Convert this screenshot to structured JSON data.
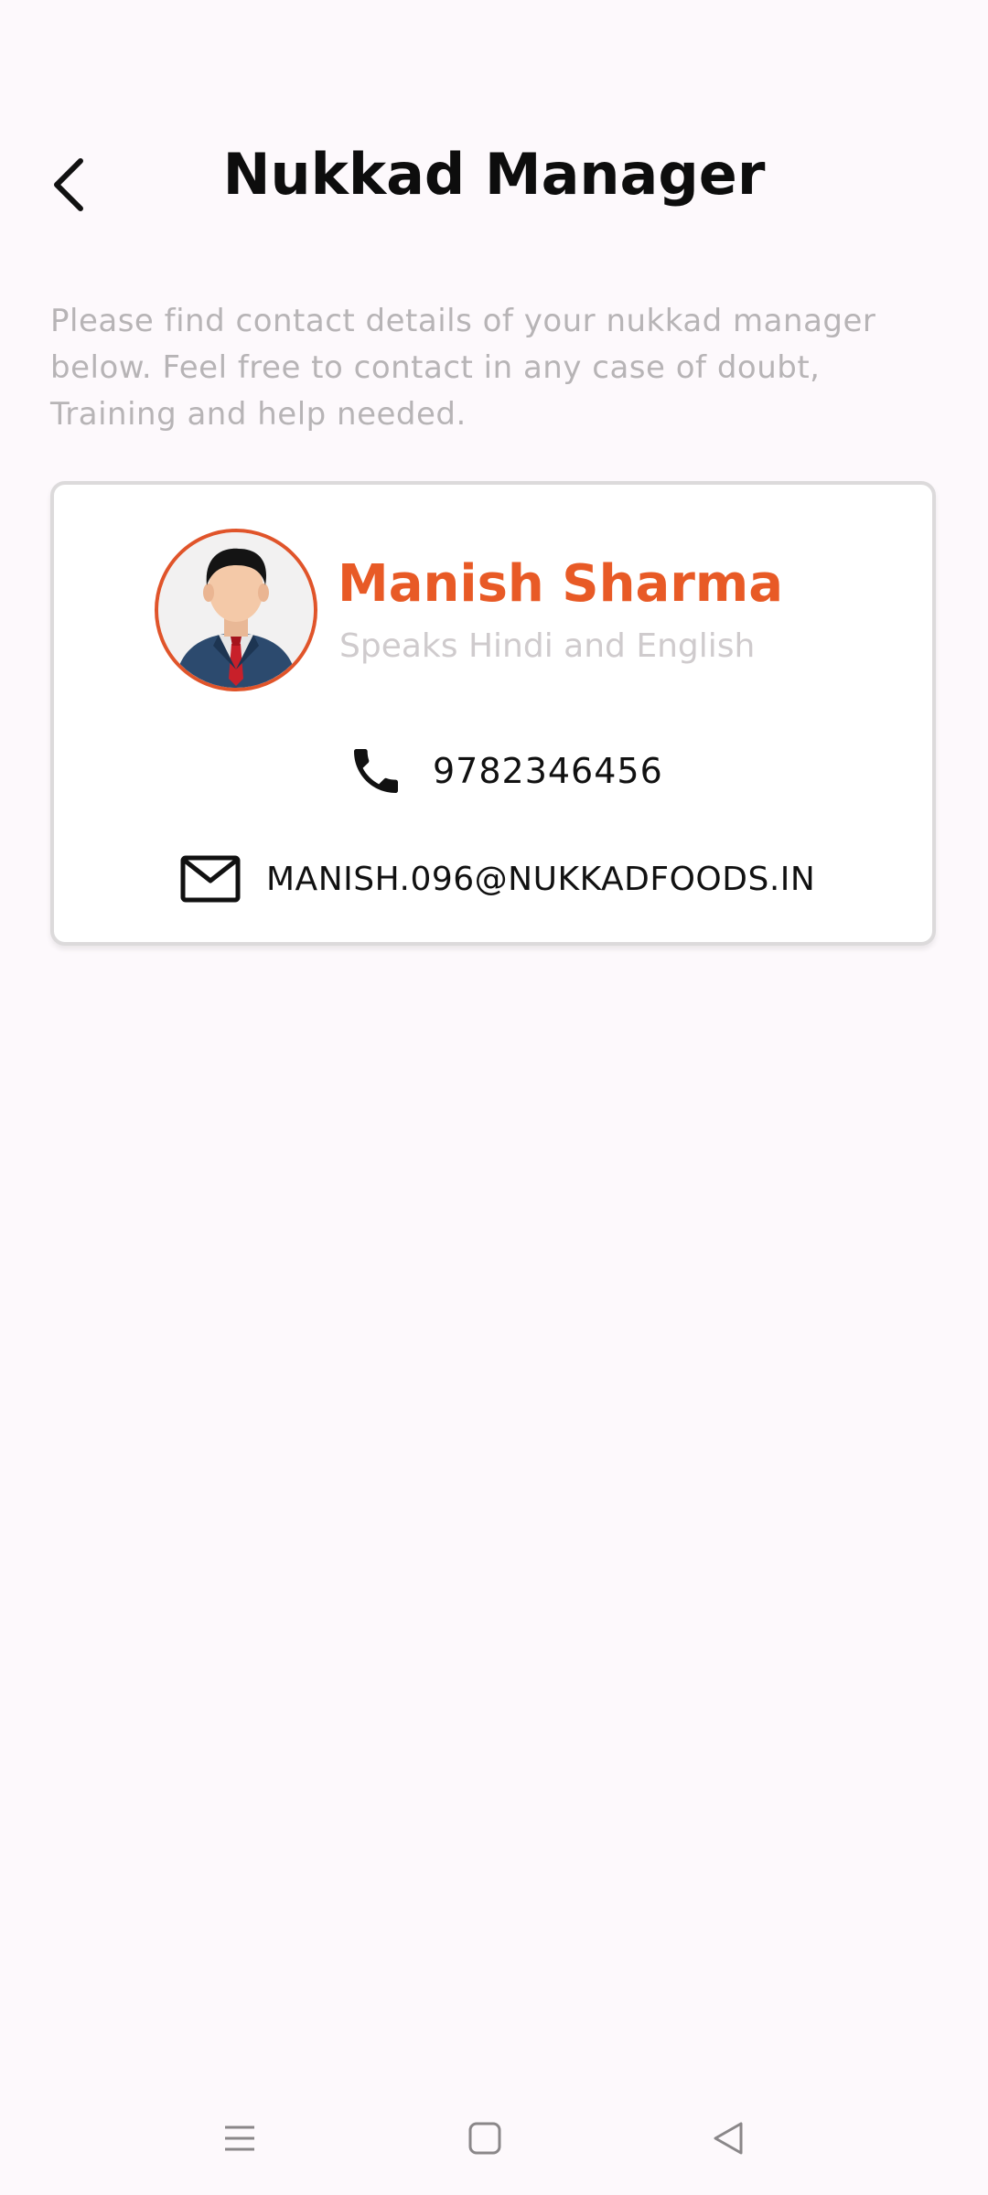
{
  "header": {
    "title": "Nukkad Manager",
    "back_icon": "chevron-left-icon"
  },
  "intro": {
    "text": "Please find contact details of your nukkad manager below. Feel free to contact in any case of doubt, Training and help needed."
  },
  "manager": {
    "name": "Manish Sharma",
    "languages": "Speaks Hindi and English",
    "phone": "9782346456",
    "email": "MANISH.096@NUKKADFOODS.IN",
    "avatar_icon": "businessman-avatar",
    "phone_icon": "phone-icon",
    "email_icon": "mail-icon"
  },
  "colors": {
    "accent": "#e85a26",
    "background": "#fdf9fc",
    "muted_text": "#b7b4b6"
  },
  "nav": {
    "icons": [
      "menu-icon",
      "home-square-icon",
      "back-triangle-icon"
    ]
  }
}
